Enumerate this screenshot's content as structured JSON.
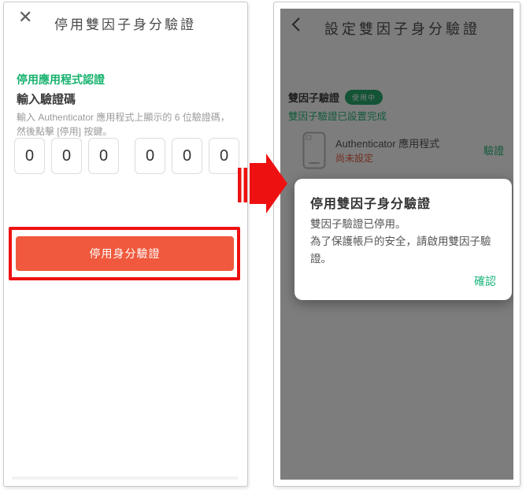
{
  "colors": {
    "accent_green": "#17B26E",
    "button_orange": "#F0593D",
    "annotation_red": "#EE1111",
    "warning_orange": "#E8512E",
    "dim_overlay": "rgba(18,18,18,0.55)"
  },
  "left": {
    "close_glyph": "✕",
    "title": "停用雙因子身分驗證",
    "section_title": "停用應用程式認證",
    "code_label": "輸入驗證碼",
    "helper_lines": [
      "輸入 Authenticator 應用程式上顯示的 6 位驗證碼，",
      "然後點擊 [停用] 按鍵。"
    ],
    "code_digits": [
      "0",
      "0",
      "0",
      "0",
      "0",
      "0"
    ],
    "disable_button_label": "停用身分驗證"
  },
  "right": {
    "title": "設定雙因子身分驗證",
    "status_label": "雙因子驗證",
    "status_badge": "使用中",
    "status_note": "雙因子驗證已設置完成",
    "method": {
      "name": "Authenticator 應用程式",
      "status": "尚未設定",
      "action_label": "驗證"
    },
    "modal": {
      "title": "停用雙因子身分驗證",
      "body_lines": [
        "雙因子驗證已停用。",
        "為了保護帳戶的安全，請啟用雙因子驗證。"
      ],
      "confirm_label": "確認"
    }
  },
  "icons": {
    "close": "close-icon",
    "back": "back-chevron-icon",
    "smartphone": "smartphone-icon",
    "arrow": "striped-right-arrow-icon"
  }
}
